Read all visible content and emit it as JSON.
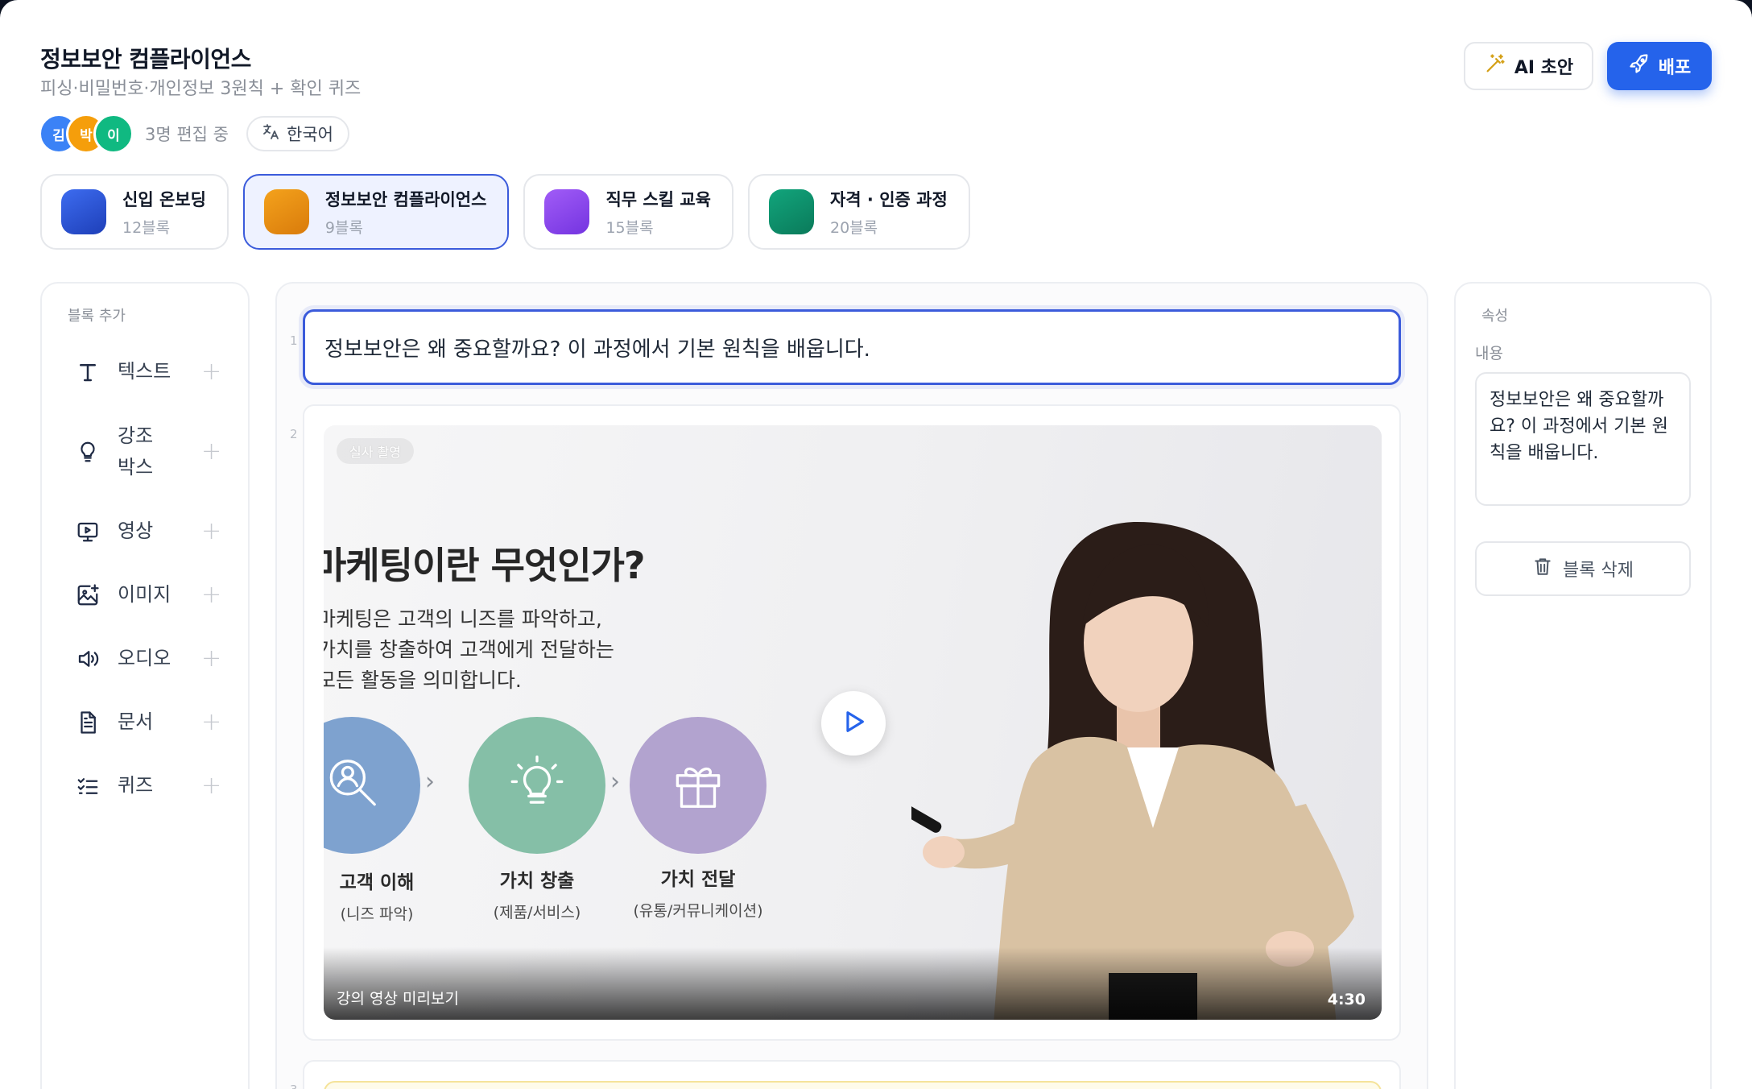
{
  "header": {
    "title": "정보보안 컴플라이언스",
    "subtitle": "피싱·비밀번호·개인정보 3원칙 + 확인 퀴즈",
    "ai_button": "AI 초안",
    "deploy_button": "배포"
  },
  "collaborators": {
    "avatars": [
      {
        "initial": "김",
        "color": "#3b82f6"
      },
      {
        "initial": "박",
        "color": "#f59e0b"
      },
      {
        "initial": "이",
        "color": "#10b981"
      }
    ],
    "editing_text": "3명 편집 중",
    "language": "한국어"
  },
  "courses": [
    {
      "name": "신입 온보딩",
      "count": "12블록",
      "color": "#2f55d4",
      "active": false
    },
    {
      "name": "정보보안 컴플라이언스",
      "count": "9블록",
      "color": "#e58a12",
      "active": true
    },
    {
      "name": "직무 스킬 교육",
      "count": "15블록",
      "color": "#8b4cf0",
      "active": false
    },
    {
      "name": "자격 · 인증 과정",
      "count": "20블록",
      "color": "#0e8f6c",
      "active": false
    }
  ],
  "sidebar": {
    "heading": "블록 추가",
    "items": [
      {
        "label": "텍스트",
        "icon": "text-icon"
      },
      {
        "label": "강조 박스",
        "icon": "lightbulb-icon"
      },
      {
        "label": "영상",
        "icon": "video-icon"
      },
      {
        "label": "이미지",
        "icon": "image-icon"
      },
      {
        "label": "오디오",
        "icon": "audio-icon"
      },
      {
        "label": "문서",
        "icon": "document-icon"
      },
      {
        "label": "퀴즈",
        "icon": "quiz-icon"
      }
    ]
  },
  "editor": {
    "blocks": [
      {
        "number": "1",
        "type": "text",
        "text": "정보보안은 왜 중요할까요? 이 과정에서 기본 원칙을 배웁니다."
      },
      {
        "number": "2",
        "type": "video"
      },
      {
        "number": "3",
        "type": "callout"
      }
    ],
    "video": {
      "badge": "실사 촬영",
      "slide_title": "마케팅이란 무엇인가?",
      "slide_lines": [
        "마케팅은 고객의 니즈를 파악하고,",
        "가치를 창출하여 고객에게 전달하는",
        "모든 활동을 의미합니다."
      ],
      "steps": [
        {
          "title": "고객 이해",
          "sub": "(니즈 파악)"
        },
        {
          "title": "가치 창출",
          "sub": "(제품/서비스)"
        },
        {
          "title": "가치 전달",
          "sub": "(유통/커뮤니케이션)"
        }
      ],
      "caption": "강의 영상 미리보기",
      "duration": "4:30"
    }
  },
  "properties": {
    "heading": "속성",
    "content_label": "내용",
    "content_value": "정보보안은 왜 중요할까요? 이 과정에서 기본 원칙을 배웁니다.",
    "delete_button": "블록 삭제"
  }
}
